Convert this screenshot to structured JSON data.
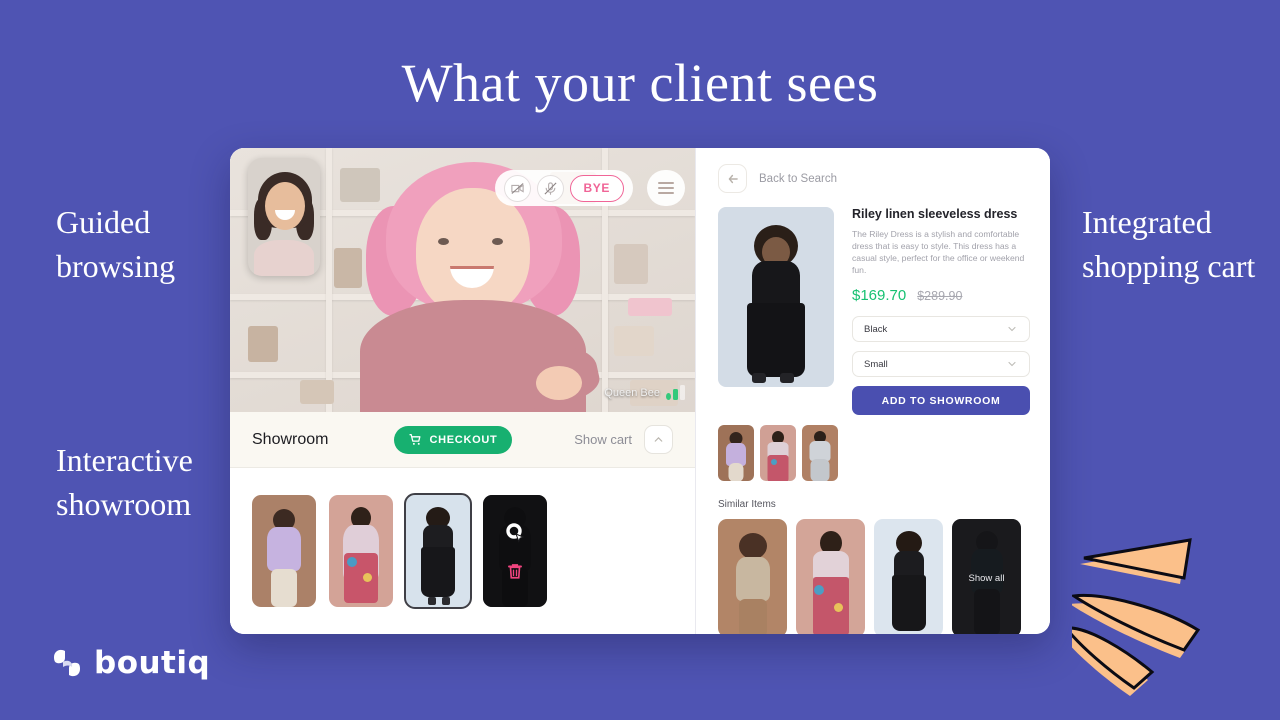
{
  "headline": "What your client sees",
  "theme": {
    "background": "#4f54b3",
    "accent_purple": "#4a4fb0",
    "accent_green": "#16c172",
    "checkout_green": "#17b070",
    "bye_pink": "#f06597",
    "peach": "#fbc08a"
  },
  "captions": {
    "guided": "Guided browsing",
    "interactive": "Interactive showroom",
    "cart": "Integrated shopping cart"
  },
  "logo": {
    "text": "boutiq",
    "mark": "boutiq-swirl-icon"
  },
  "video": {
    "controls": [
      {
        "name": "camera-off-icon",
        "label": ""
      },
      {
        "name": "mic-off-icon",
        "label": ""
      }
    ],
    "bye_label": "BYE",
    "menu": "hamburger-menu-icon",
    "participant_name": "Queen Bee",
    "signal": "signal-strength-icon"
  },
  "showroom": {
    "title": "Showroom",
    "checkout_label": "CHECKOUT",
    "cart_icon": "shopping-cart-icon",
    "show_cart_label": "Show cart",
    "chevron": "chevron-up-icon",
    "items": [
      {
        "name": "lavender-sweater-thumb",
        "selected": false
      },
      {
        "name": "floral-dress-thumb",
        "selected": false
      },
      {
        "name": "black-slip-dress-thumb",
        "selected": true
      },
      {
        "name": "remove-item-thumb",
        "selected": false,
        "overlay_icons": [
          "cursor-click-icon",
          "trash-icon"
        ]
      }
    ]
  },
  "product_panel": {
    "back_label": "Back to Search",
    "back_icon": "arrow-left-icon",
    "title": "Riley linen sleeveless dress",
    "description": "The Riley Dress is a stylish and comfortable dress that is easy to style. This dress has a casual style, perfect for the office or weekend fun.",
    "price_current": "$169.70",
    "price_original": "$289.90",
    "color_select": {
      "value": "Black",
      "chevron": "chevron-down-icon"
    },
    "size_select": {
      "value": "Small",
      "chevron": "chevron-down-icon"
    },
    "add_button": "ADD TO SHOWROOM",
    "variants": [
      {
        "name": "variant-lavender-thumb"
      },
      {
        "name": "variant-floral-thumb"
      },
      {
        "name": "variant-grey-set-thumb"
      }
    ],
    "similar_title": "Similar Items",
    "similar_items": [
      {
        "name": "similar-curly-hair-thumb",
        "overlay": ""
      },
      {
        "name": "similar-floral-thumb",
        "overlay": ""
      },
      {
        "name": "similar-black-dress-thumb",
        "overlay": ""
      },
      {
        "name": "similar-show-all-thumb",
        "overlay": "Show all"
      }
    ]
  }
}
